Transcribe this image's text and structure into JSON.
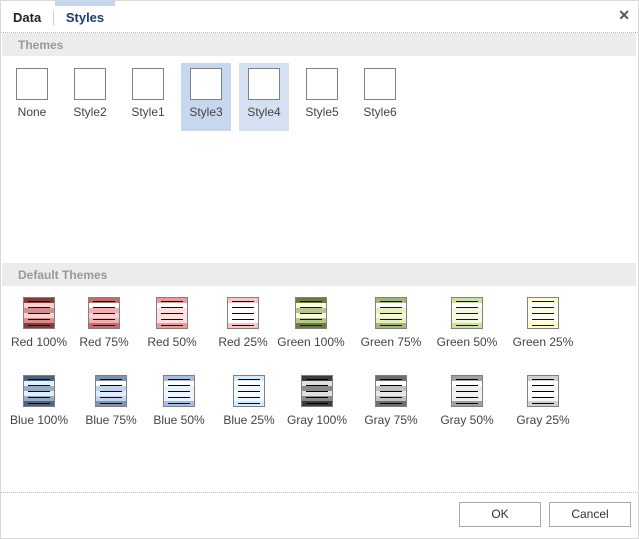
{
  "tabs": [
    {
      "label": "Data",
      "active": false
    },
    {
      "label": "Styles",
      "active": true
    }
  ],
  "close_icon": "close-icon",
  "themes": {
    "header": "Themes",
    "items": [
      {
        "label": "None",
        "state": "normal"
      },
      {
        "label": "Style2",
        "state": "normal"
      },
      {
        "label": "Style1",
        "state": "normal"
      },
      {
        "label": "Style3",
        "state": "selected"
      },
      {
        "label": "Style4",
        "state": "hover"
      },
      {
        "label": "Style5",
        "state": "normal"
      },
      {
        "label": "Style6",
        "state": "normal"
      }
    ]
  },
  "default_themes": {
    "header": "Default Themes",
    "items": [
      {
        "label": "Red 100%",
        "dark": "#8b3a3a",
        "mid": "#d98c8c",
        "light": "#ffd0d0",
        "alt": "#ffd0d0",
        "line": "#2a0000"
      },
      {
        "label": "Red 75%",
        "dark": "#c76b6b",
        "mid": "#f4b0b0",
        "light": "#ffffff",
        "alt": "#ffd0d0",
        "line": "#2a0000"
      },
      {
        "label": "Red 50%",
        "dark": "#ef9a9a",
        "mid": "#fde0e0",
        "light": "#ffffff",
        "alt": "#ffe0e0",
        "line": "#2a0000"
      },
      {
        "label": "Red 25%",
        "dark": "#f9c5c5",
        "mid": "#ffffff",
        "light": "#ffffff",
        "alt": "#ffffff",
        "line": "#2a0000"
      },
      {
        "label": "Green 100%",
        "dark": "#6b7d3a",
        "mid": "#b4c88a",
        "light": "#fbfde0",
        "alt": "#fbfde0",
        "line": "#1a1a00"
      },
      {
        "label": "Green 75%",
        "dark": "#a2b876",
        "mid": "#e4f0c0",
        "light": "#ffffff",
        "alt": "#f4fbd8",
        "line": "#1a1a00"
      },
      {
        "label": "Green 50%",
        "dark": "#cde2a0",
        "mid": "#f2f8e0",
        "light": "#ffffff",
        "alt": "#f6fbe6",
        "line": "#1a1a00"
      },
      {
        "label": "Green 25%",
        "dark": "#fdfdc8",
        "mid": "#ffffe8",
        "light": "#ffffff",
        "alt": "#ffffff",
        "line": "#1a1a00"
      },
      {
        "label": "Blue 100%",
        "dark": "#4c6282",
        "mid": "#98aac4",
        "light": "#dff0ff",
        "alt": "#dff0ff",
        "line": "#000820"
      },
      {
        "label": "Blue 75%",
        "dark": "#7d93b4",
        "mid": "#c2d4ec",
        "light": "#ffffff",
        "alt": "#e0eeff",
        "line": "#000820"
      },
      {
        "label": "Blue 50%",
        "dark": "#a5bde0",
        "mid": "#eaf2ff",
        "light": "#ffffff",
        "alt": "#eef6ff",
        "line": "#000820"
      },
      {
        "label": "Blue 25%",
        "dark": "#d3ecfb",
        "mid": "#f0f8ff",
        "light": "#ffffff",
        "alt": "#ffffff",
        "line": "#000820"
      },
      {
        "label": "Gray 100%",
        "dark": "#3c3c3c",
        "mid": "#8a8a8a",
        "light": "#e0e0e0",
        "alt": "#e0e0e0",
        "line": "#000000"
      },
      {
        "label": "Gray 75%",
        "dark": "#6e6e6e",
        "mid": "#c0c0c0",
        "light": "#ffffff",
        "alt": "#e8e8e8",
        "line": "#000000"
      },
      {
        "label": "Gray 50%",
        "dark": "#a0a0a0",
        "mid": "#eeeeee",
        "light": "#ffffff",
        "alt": "#f2f2f2",
        "line": "#000000"
      },
      {
        "label": "Gray 25%",
        "dark": "#d0d0d0",
        "mid": "#f6f6f6",
        "light": "#ffffff",
        "alt": "#ffffff",
        "line": "#000000"
      }
    ]
  },
  "buttons": {
    "ok": "OK",
    "cancel": "Cancel"
  }
}
